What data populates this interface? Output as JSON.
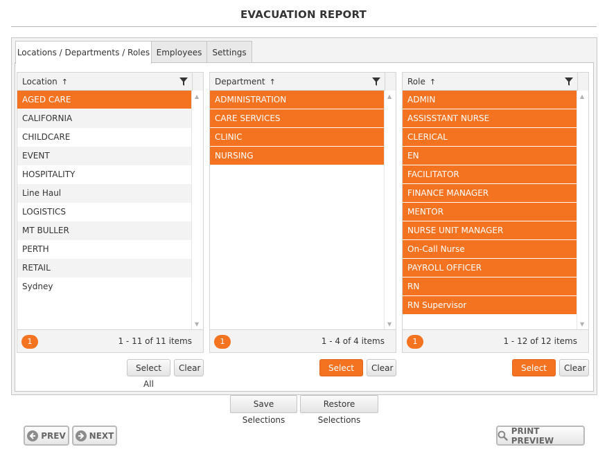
{
  "page": {
    "title": "EVACUATION REPORT"
  },
  "tabs": [
    {
      "label": "Locations / Departments / Roles",
      "active": true
    },
    {
      "label": "Employees",
      "active": false
    },
    {
      "label": "Settings",
      "active": false
    }
  ],
  "colors": {
    "accent": "#f47321",
    "panel": "#f3f3f3",
    "border": "#c5c5c5"
  },
  "grids": {
    "location": {
      "header": "Location",
      "sort_icon": "sort-ascending-icon",
      "rows": [
        "AGED CARE",
        "CALIFORNIA",
        "CHILDCARE",
        "EVENT",
        "HOSPITALITY",
        "Line Haul",
        "LOGISTICS",
        "MT BULLER",
        "PERTH",
        "RETAIL",
        "Sydney"
      ],
      "selected": [
        "AGED CARE"
      ],
      "page": "1",
      "page_info": "1 - 11 of 11 items",
      "select_all_label": "Select All",
      "clear_label": "Clear",
      "select_all_highlighted": false
    },
    "department": {
      "header": "Department",
      "sort_icon": "sort-ascending-icon",
      "rows": [
        "ADMINISTRATION",
        "CARE SERVICES",
        "CLINIC",
        "NURSING"
      ],
      "selected": [
        "ADMINISTRATION",
        "CARE SERVICES",
        "CLINIC",
        "NURSING"
      ],
      "page": "1",
      "page_info": "1 - 4 of 4 items",
      "select_all_label": "Select All",
      "clear_label": "Clear",
      "select_all_highlighted": true
    },
    "role": {
      "header": "Role",
      "sort_icon": "sort-ascending-icon",
      "rows": [
        "ADMIN",
        "ASSISSTANT NURSE",
        "CLERICAL",
        "EN",
        "FACILITATOR",
        "FINANCE MANAGER",
        "MENTOR",
        "NURSE UNIT MANAGER",
        "On-Call Nurse",
        "PAYROLL OFFICER",
        "RN",
        "RN Supervisor"
      ],
      "selected": [
        "ADMIN",
        "ASSISSTANT NURSE",
        "CLERICAL",
        "EN",
        "FACILITATOR",
        "FINANCE MANAGER",
        "MENTOR",
        "NURSE UNIT MANAGER",
        "On-Call Nurse",
        "PAYROLL OFFICER",
        "RN",
        "RN Supervisor"
      ],
      "page": "1",
      "page_info": "1 - 12 of 12 items",
      "select_all_label": "Select All",
      "clear_label": "Clear",
      "select_all_highlighted": true
    }
  },
  "actions": {
    "save_label": "Save Selections",
    "restore_label": "Restore Selections"
  },
  "nav": {
    "prev_label": "PREV",
    "next_label": "NEXT",
    "print_preview_label": "PRINT PREVIEW"
  }
}
